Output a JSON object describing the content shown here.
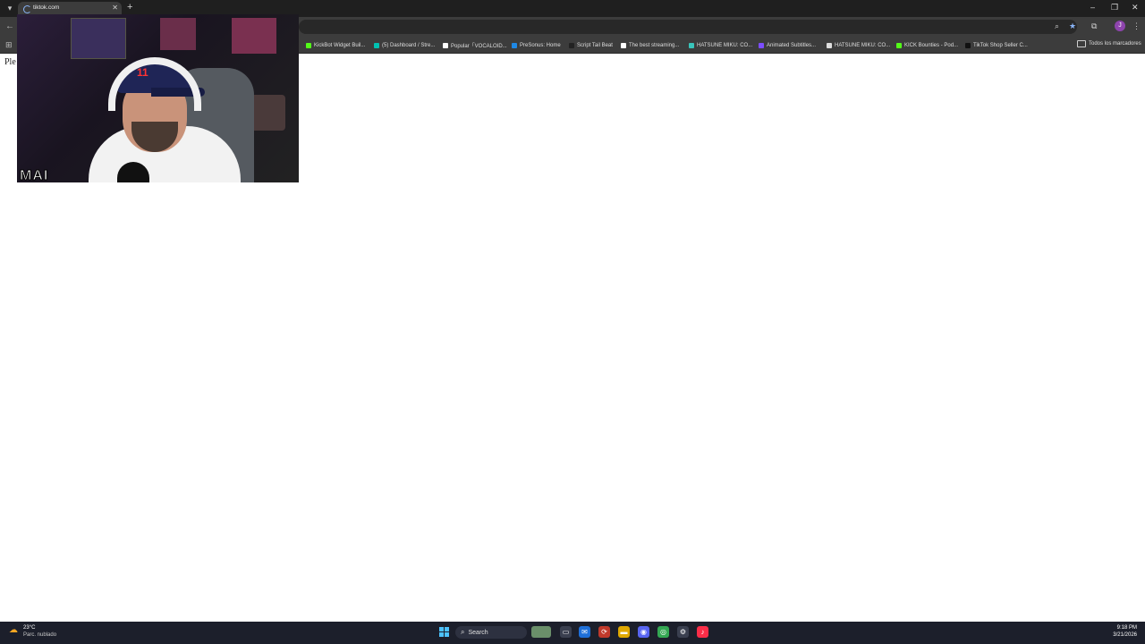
{
  "browser": {
    "tab_title": "tiktok.com",
    "bookmarks": [
      {
        "label": "KickBot Widget Buil...",
        "color": "#53fc18"
      },
      {
        "label": "(5) Dashboard / Stre...",
        "color": "#00c2b2"
      },
      {
        "label": "Popular「VOCALOID...",
        "color": "#ffffff"
      },
      {
        "label": "PreSonus: Home",
        "color": "#1e88e5"
      },
      {
        "label": "Script Tail Beat",
        "color": "#222222"
      },
      {
        "label": "The best streaming...",
        "color": "#ffffff"
      },
      {
        "label": "HATSUNE MIKU: CO...",
        "color": "#39c5bb"
      },
      {
        "label": "Animated Subtitles...",
        "color": "#7c4dff"
      },
      {
        "label": "HATSUNE MIKU: CO...",
        "color": "#dddddd"
      },
      {
        "label": "KICK Bounties - Pod...",
        "color": "#53fc18"
      },
      {
        "label": "TikTok Shop Seller C...",
        "color": "#111111"
      }
    ],
    "all_bookmarks_label": "Todos los marcadores",
    "profile_initial": "J"
  },
  "page": {
    "text": "Ple"
  },
  "webcam": {
    "overlay_text": "MAI",
    "cap_logo": "11"
  },
  "taskbar": {
    "weather_temp": "23°C",
    "weather_desc": "Parc. nublado",
    "search_label": "Search",
    "time": "9:18 PM",
    "date": "3/21/2026"
  }
}
